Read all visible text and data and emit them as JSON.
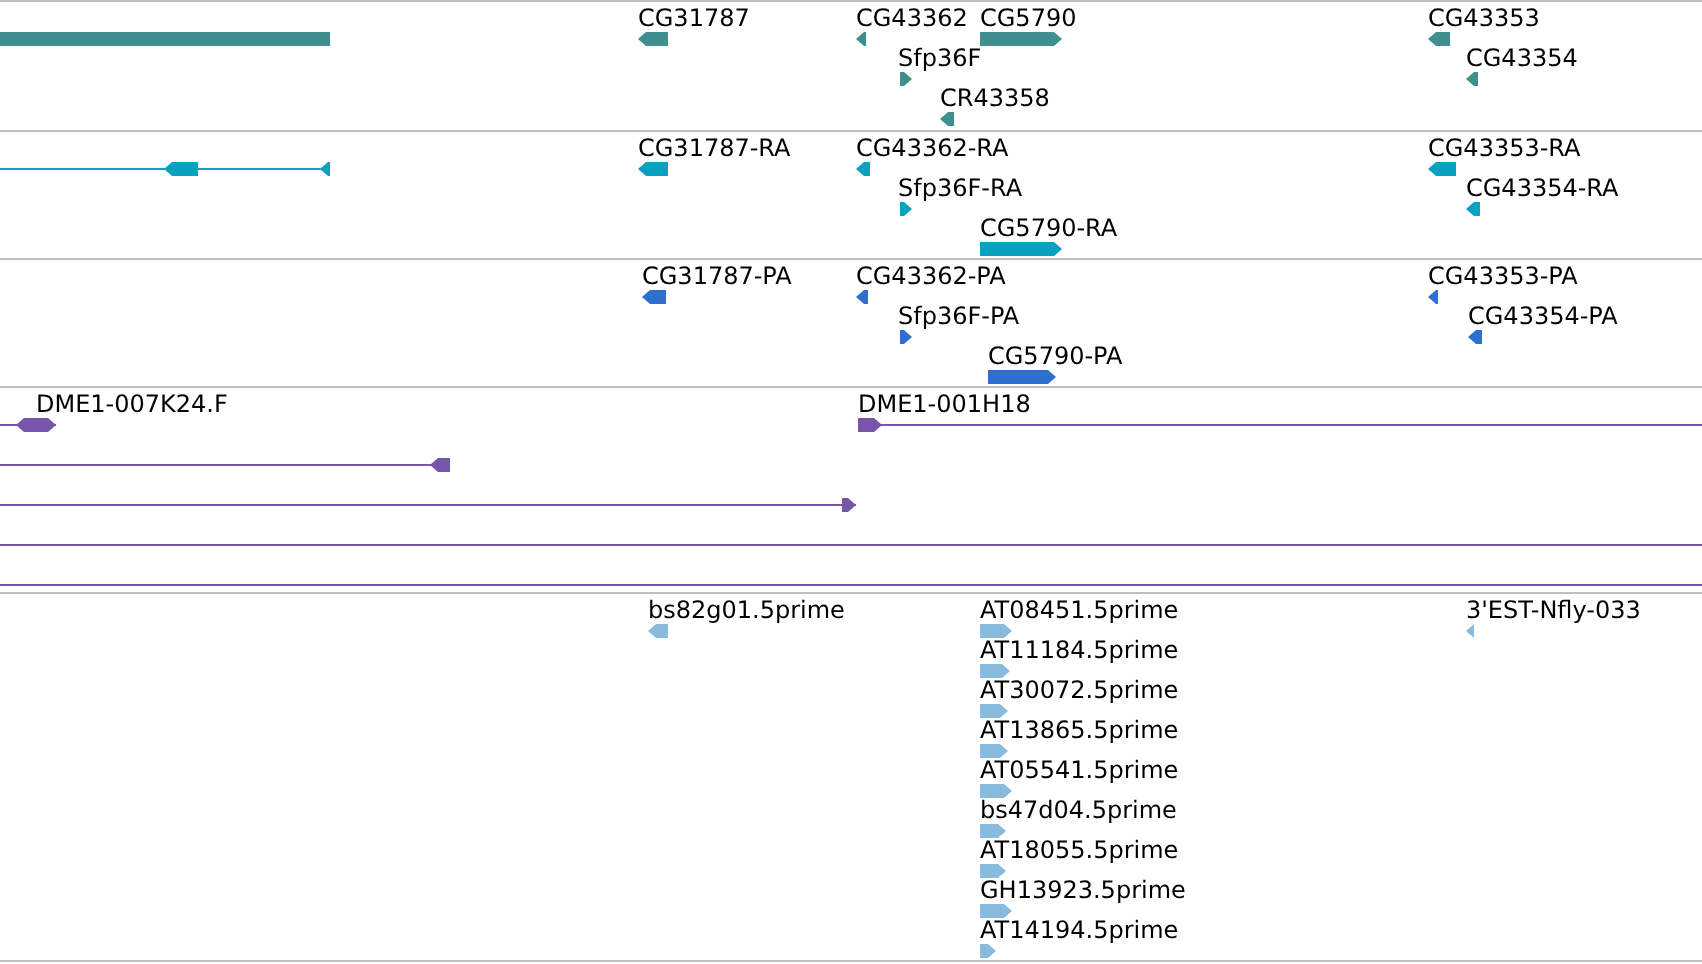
{
  "tracks": [
    {
      "color": "#3f8f8f",
      "features": [
        {
          "kind": "plain"
        },
        {
          "label": "CG31787",
          "kind": "reverse"
        },
        {
          "label": "CG43362",
          "kind": "reverse"
        },
        {
          "label": "CG5790",
          "kind": "forward"
        },
        {
          "label": "Sfp36F",
          "kind": "forward"
        },
        {
          "label": "CR43358",
          "kind": "reverse"
        },
        {
          "label": "CG43353",
          "kind": "reverse"
        },
        {
          "label": "CG43354",
          "kind": "reverse"
        }
      ]
    },
    {
      "color": "#0aa0c0",
      "features": [
        {
          "kind": "reverse"
        },
        {
          "label": "CG31787-RA",
          "kind": "reverse"
        },
        {
          "label": "CG43362-RA",
          "kind": "reverse"
        },
        {
          "label": "Sfp36F-RA",
          "kind": "forward"
        },
        {
          "label": "CG5790-RA",
          "kind": "forward"
        },
        {
          "label": "CG43353-RA",
          "kind": "reverse"
        },
        {
          "label": "CG43354-RA",
          "kind": "reverse"
        }
      ]
    },
    {
      "color": "#2f6fd0",
      "features": [
        {
          "label": "CG31787-PA",
          "kind": "reverse"
        },
        {
          "label": "CG43362-PA",
          "kind": "reverse"
        },
        {
          "label": "Sfp36F-PA",
          "kind": "forward"
        },
        {
          "label": "CG5790-PA",
          "kind": "forward"
        },
        {
          "label": "CG43353-PA",
          "kind": "reverse"
        },
        {
          "label": "CG43354-PA",
          "kind": "reverse"
        }
      ]
    },
    {
      "color": "#7755aa",
      "features": [
        {
          "label": "DME1-007K24.F",
          "kind": "both"
        },
        {
          "label": "DME1-001H18",
          "kind": "forward"
        },
        {
          "kind": "reverse"
        },
        {
          "kind": "forward"
        },
        {
          "kind": "plain"
        },
        {
          "kind": "plain"
        }
      ]
    },
    {
      "color": "#88bbdd",
      "features": [
        {
          "label": "bs82g01.5prime",
          "kind": "reverse"
        },
        {
          "label": "AT08451.5prime",
          "kind": "forward"
        },
        {
          "label": "AT11184.5prime",
          "kind": "forward"
        },
        {
          "label": "AT30072.5prime",
          "kind": "forward"
        },
        {
          "label": "AT13865.5prime",
          "kind": "forward"
        },
        {
          "label": "AT05541.5prime",
          "kind": "forward"
        },
        {
          "label": "bs47d04.5prime",
          "kind": "forward"
        },
        {
          "label": "AT18055.5prime",
          "kind": "forward"
        },
        {
          "label": "GH13923.5prime",
          "kind": "forward"
        },
        {
          "label": "AT14194.5prime",
          "kind": "forward"
        },
        {
          "label": "3'EST-Nfly-033",
          "kind": "reverse"
        }
      ]
    }
  ]
}
